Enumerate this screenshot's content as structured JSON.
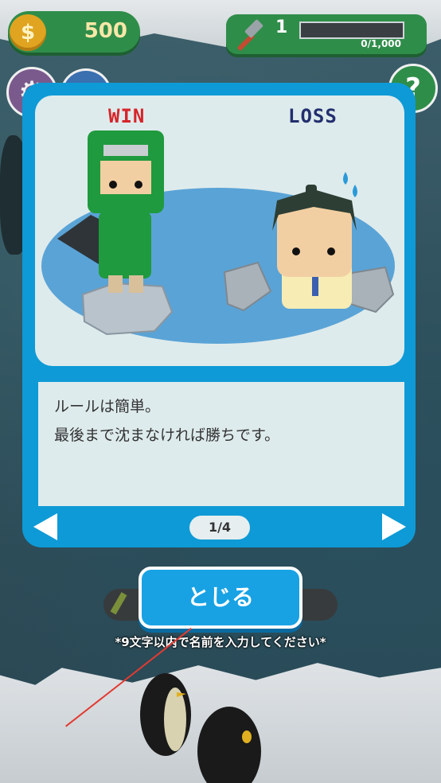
{
  "hud": {
    "coins": "500",
    "coin_symbol": "$",
    "level": "1",
    "xp": "0/1,000",
    "xp_progress": 0
  },
  "dialog": {
    "win_label": "WIN",
    "loss_label": "LOSS",
    "rule_line1": "ルールは簡単。",
    "rule_line2": "最後まで沈まなければ勝ちです。",
    "page_indicator": "1/4",
    "close_label": "とじる"
  },
  "background": {
    "name_hint": "*9文字以内で名前を入力してください*"
  },
  "colors": {
    "hud_green": "#2f8d4a",
    "dialog_blue": "#0e9ad6",
    "win_red": "#d6252b",
    "loss_navy": "#232f6e"
  },
  "icons": [
    "coin-icon",
    "hammer-icon",
    "gear-icon",
    "shop-icon",
    "help-icon",
    "pencil-icon",
    "prev-arrow-icon",
    "next-arrow-icon"
  ]
}
